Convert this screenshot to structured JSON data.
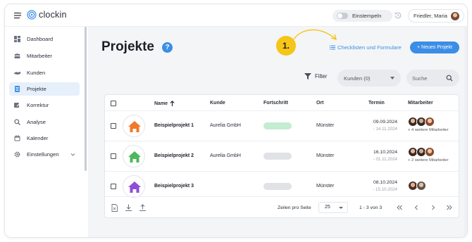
{
  "app": {
    "name": "clockin",
    "clock_in_label": "Einstempeln",
    "user_name": "Friedler, Maria"
  },
  "sidebar": {
    "items": [
      {
        "label": "Dashboard",
        "icon": "dashboard-icon"
      },
      {
        "label": "Mitarbeiter",
        "icon": "employees-icon"
      },
      {
        "label": "Kunden",
        "icon": "customers-icon"
      },
      {
        "label": "Projekte",
        "icon": "projects-icon",
        "active": true
      },
      {
        "label": "Korrektur",
        "icon": "correction-icon"
      },
      {
        "label": "Analyse",
        "icon": "analysis-icon"
      },
      {
        "label": "Kalender",
        "icon": "calendar-icon"
      },
      {
        "label": "Einstellungen",
        "icon": "settings-icon"
      }
    ]
  },
  "page": {
    "title": "Projekte",
    "help": "?",
    "step_badge": "1.",
    "checklist_link": "Checklisten und Formulare",
    "new_project_button": "+ Neues Projekt",
    "filter_label": "Filter",
    "customer_select": "Kunden (0)",
    "search_placeholder": "Suche"
  },
  "table": {
    "headers": {
      "name": "Name",
      "customer": "Kunde",
      "progress": "Fortschritt",
      "location": "Ort",
      "date": "Termin",
      "staff": "Mitarbeiter"
    },
    "rows": [
      {
        "name": "Beispielprojekt 1",
        "customer": "Aurelia GmbH",
        "progress": 1.0,
        "location": "Münster",
        "date_start": "09.09.2024",
        "date_end": "- 14.11.2024",
        "house_color": "#f07a2a",
        "more_staff": "+ 4 weitere Mitarbeiter"
      },
      {
        "name": "Beispielprojekt 2",
        "customer": "Aurelia GmbH",
        "progress": 0.0,
        "location": "Münster",
        "date_start": "16.10.2024",
        "date_end": "- 01.11.2024",
        "house_color": "#4cb85c",
        "more_staff": "+ 2 weitere Mitarbeiter"
      },
      {
        "name": "Beispielprojekt 3",
        "customer": "",
        "progress": 0.0,
        "location": "Münster",
        "date_start": "08.10.2024",
        "date_end": "- 15.10.2024",
        "house_color": "#8e4fd6",
        "more_staff": ""
      }
    ],
    "footer": {
      "rows_per_page_label": "Zeilen pro Seite",
      "rows_per_page_value": "25",
      "page_info": "1 - 3 von 3"
    }
  },
  "colors": {
    "accent": "#3b8ee6",
    "badge": "#f5c518",
    "progress_fill": "#c3ecd1"
  }
}
